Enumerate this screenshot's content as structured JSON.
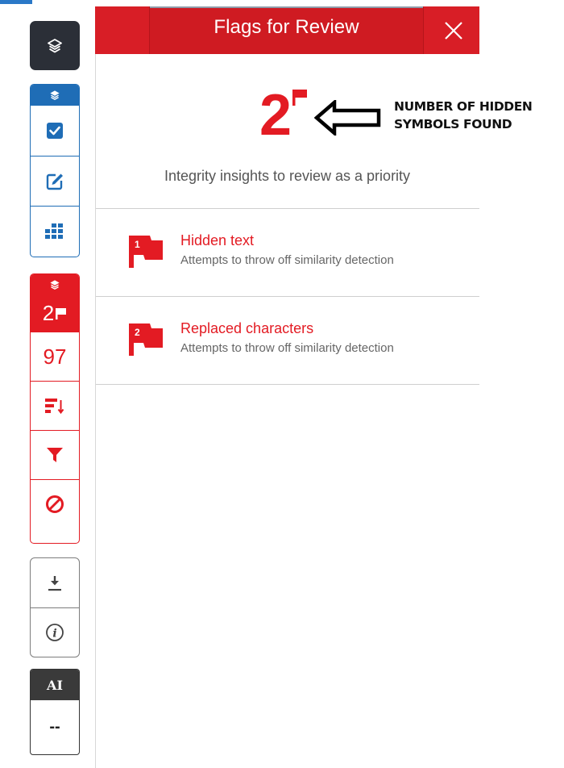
{
  "panel": {
    "title": "Flags for Review",
    "close_label": "Close"
  },
  "summary": {
    "count": "2",
    "subtitle": "Integrity insights to review as a priority"
  },
  "annotation": {
    "line1": "NUMBER OF HIDDEN",
    "line2": "SYMBOLS FOUND"
  },
  "flags": [
    {
      "number": "1",
      "title": "Hidden text",
      "description": "Attempts to throw off similarity detection"
    },
    {
      "number": "2",
      "title": "Replaced characters",
      "description": "Attempts to throw off similarity detection"
    }
  ],
  "toolbar": {
    "flags_count": "2",
    "score": "97",
    "ai_label": "AI",
    "ai_value": "--"
  },
  "colors": {
    "accent_red": "#e31b23",
    "accent_blue": "#1f6db6",
    "dark_button": "#2b2f37"
  },
  "icons": [
    "layers-icon",
    "checkbox-icon",
    "edit-icon",
    "grid-icon",
    "flag-icon",
    "sort-icon",
    "filter-icon",
    "block-icon",
    "download-icon",
    "info-icon",
    "close-icon",
    "arrow-left-icon"
  ]
}
